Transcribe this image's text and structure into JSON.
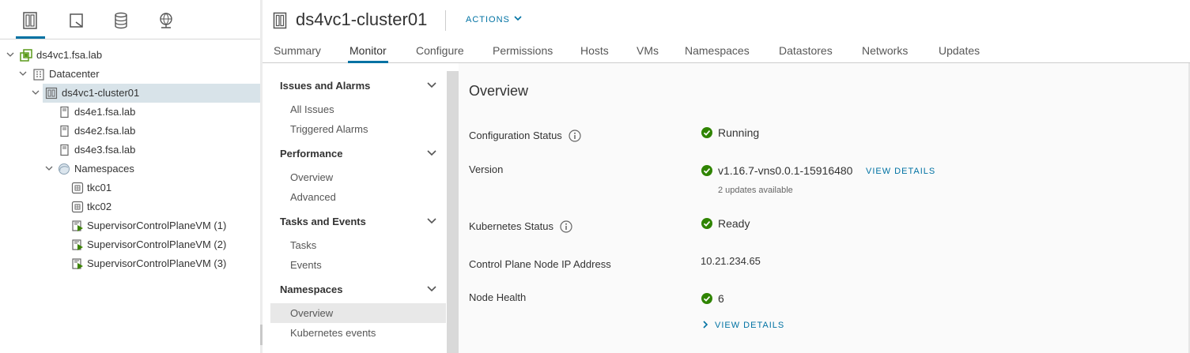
{
  "left_tabs": [
    {
      "icon": "hosts-clusters-icon",
      "active": true
    },
    {
      "icon": "vms-templates-icon",
      "active": false
    },
    {
      "icon": "storage-icon",
      "active": false
    },
    {
      "icon": "networking-icon",
      "active": false
    }
  ],
  "tree": {
    "vcenter": "ds4vc1.fsa.lab",
    "datacenter": "Datacenter",
    "cluster": "ds4vc1-cluster01",
    "hosts": [
      "ds4e1.fsa.lab",
      "ds4e2.fsa.lab",
      "ds4e3.fsa.lab"
    ],
    "namespaces_folder": "Namespaces",
    "namespaces": [
      "tkc01",
      "tkc02"
    ],
    "vms": [
      "SupervisorControlPlaneVM (1)",
      "SupervisorControlPlaneVM (2)",
      "SupervisorControlPlaneVM (3)"
    ]
  },
  "header": {
    "title": "ds4vc1-cluster01",
    "actions_label": "ACTIONS"
  },
  "tabs": [
    "Summary",
    "Monitor",
    "Configure",
    "Permissions",
    "Hosts",
    "VMs",
    "Namespaces",
    "Datastores",
    "Networks",
    "Updates"
  ],
  "active_tab": "Monitor",
  "subnav": {
    "groups": [
      {
        "title": "Issues and Alarms",
        "items": [
          "All Issues",
          "Triggered Alarms"
        ]
      },
      {
        "title": "Performance",
        "items": [
          "Overview",
          "Advanced"
        ]
      },
      {
        "title": "Tasks and Events",
        "items": [
          "Tasks",
          "Events"
        ]
      },
      {
        "title": "Namespaces",
        "items": [
          "Overview",
          "Kubernetes events"
        ]
      }
    ],
    "active_item": "Namespaces > Overview"
  },
  "overview": {
    "title": "Overview",
    "config_status_label": "Configuration Status",
    "config_status_value": "Running",
    "version_label": "Version",
    "version_value": "v1.16.7-vns0.0.1-15916480",
    "version_link": "VIEW DETAILS",
    "version_sub": "2 updates available",
    "k8s_status_label": "Kubernetes Status",
    "k8s_status_value": "Ready",
    "cp_ip_label": "Control Plane Node IP Address",
    "cp_ip_value": "10.21.234.65",
    "node_health_label": "Node Health",
    "node_health_value": "6",
    "node_health_link": "VIEW DETAILS"
  },
  "colors": {
    "accent": "#0072a3",
    "ok_green": "#2f8400",
    "selected_bg": "#d8e3e9"
  }
}
